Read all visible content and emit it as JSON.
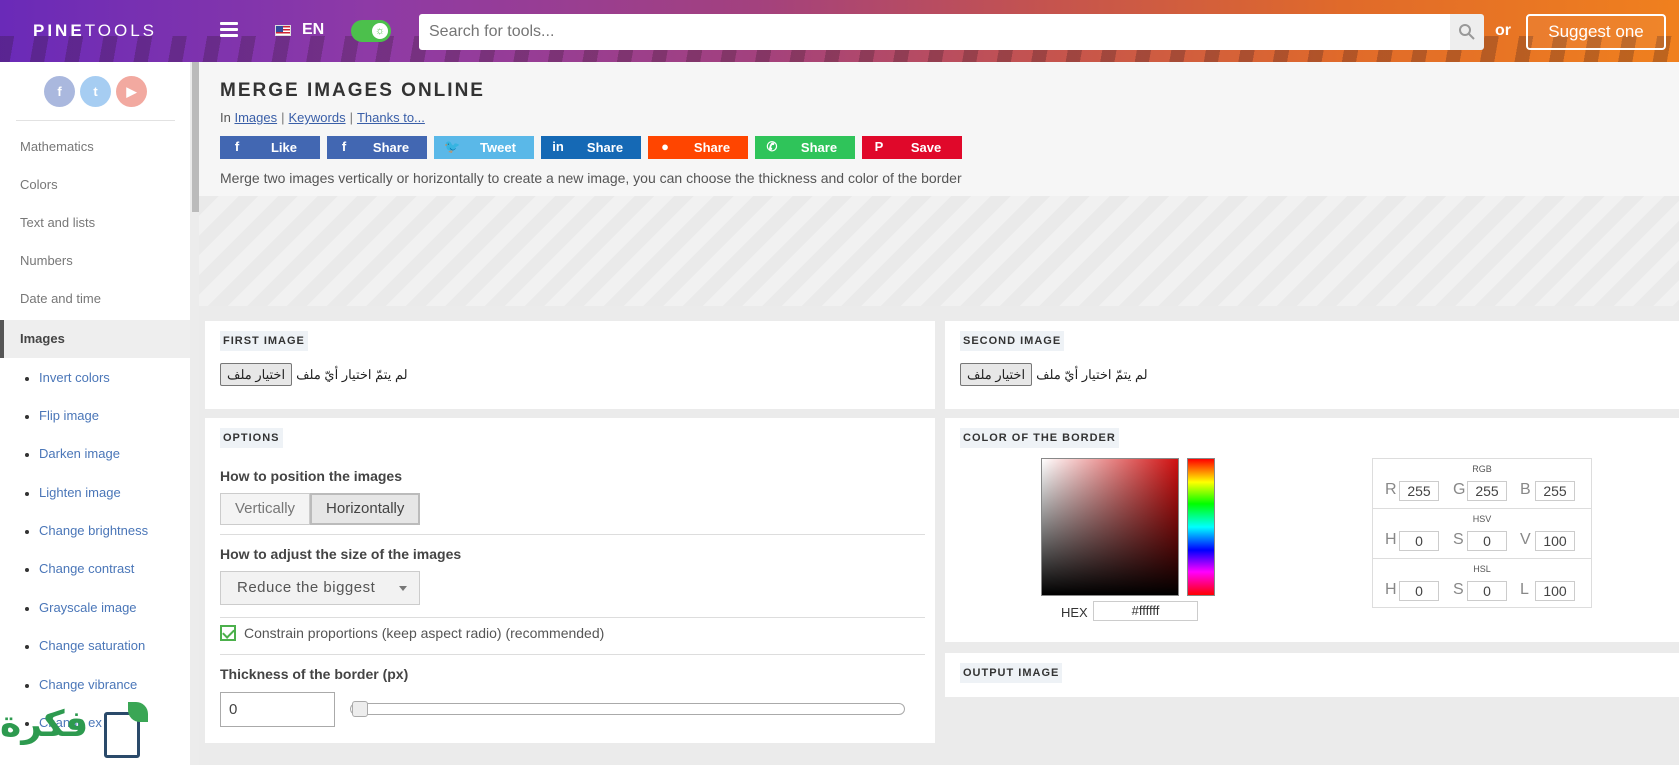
{
  "header": {
    "logo_bold": "PINE",
    "logo_light": "TOOLS",
    "language": "EN",
    "search_placeholder": "Search for tools...",
    "or_label": "or",
    "suggest_label": "Suggest one"
  },
  "sidebar": {
    "social": [
      "f",
      "t",
      "▶"
    ],
    "categories": [
      "Mathematics",
      "Colors",
      "Text and lists",
      "Numbers",
      "Date and time",
      "Images"
    ],
    "active_category": "Images",
    "subitems": [
      "Invert colors",
      "Flip image",
      "Darken image",
      "Lighten image",
      "Change brightness",
      "Change contrast",
      "Grayscale image",
      "Change saturation",
      "Change vibrance",
      "Change ex"
    ]
  },
  "page": {
    "title": "MERGE IMAGES ONLINE",
    "breadcrumb_prefix": "In",
    "breadcrumb_links": [
      "Images",
      "Keywords",
      "Thanks to..."
    ],
    "description": "Merge two images vertically or horizontally to create a new image, you can choose the thickness and color of the border"
  },
  "share_buttons": [
    {
      "label": "Like",
      "icon": "f",
      "color": "#4267b2"
    },
    {
      "label": "Share",
      "icon": "f",
      "color": "#4267b2"
    },
    {
      "label": "Tweet",
      "icon": "🐦",
      "color": "#5ab8e8"
    },
    {
      "label": "Share",
      "icon": "in",
      "color": "#1569b5"
    },
    {
      "label": "Share",
      "icon": "●",
      "color": "#ff4500"
    },
    {
      "label": "Share",
      "icon": "✆",
      "color": "#2fc45a"
    },
    {
      "label": "Save",
      "icon": "P",
      "color": "#e0082a"
    }
  ],
  "first_image": {
    "label": "FIRST IMAGE",
    "button": "اختيار ملف",
    "status": "لم يتمّ اختيار أيّ ملف"
  },
  "second_image": {
    "label": "SECOND IMAGE",
    "button": "اختيار ملف",
    "status": "لم يتمّ اختيار أيّ ملف"
  },
  "options": {
    "label": "OPTIONS",
    "position_label": "How to position the images",
    "position_options": [
      "Vertically",
      "Horizontally"
    ],
    "position_selected": "Horizontally",
    "size_label": "How to adjust the size of the images",
    "size_selected": "Reduce the biggest",
    "constrain_label": "Constrain proportions (keep aspect radio) (recommended)",
    "constrain_checked": true,
    "thickness_label": "Thickness of the border (px)",
    "thickness_value": "0"
  },
  "border_color": {
    "label": "COLOR OF THE BORDER",
    "hex_label": "HEX",
    "hex_value": "#ffffff",
    "rgb_title": "RGB",
    "rgb": {
      "R": "255",
      "G": "255",
      "B": "255"
    },
    "hsv_title": "HSV",
    "hsv": {
      "H": "0",
      "S": "0",
      "V": "100"
    },
    "hsl_title": "HSL",
    "hsl": {
      "H": "0",
      "S": "0",
      "L": "100"
    }
  },
  "output": {
    "label": "OUTPUT IMAGE"
  },
  "watermark": {
    "text": "فكرة"
  }
}
